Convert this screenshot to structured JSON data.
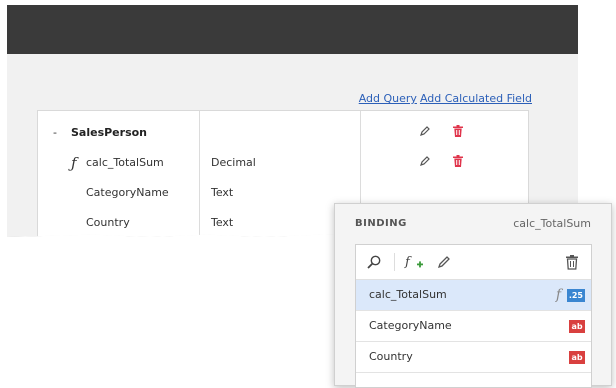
{
  "links": {
    "add_query": "Add Query",
    "add_calculated_field": "Add Calculated Field"
  },
  "table": {
    "root": {
      "toggle": "-",
      "name": "SalesPerson"
    },
    "rows": [
      {
        "name": "calc_TotalSum",
        "type": "Decimal",
        "icon": "function-icon"
      },
      {
        "name": "CategoryName",
        "type": "Text"
      },
      {
        "name": "Country",
        "type": "Text"
      }
    ]
  },
  "binding": {
    "title": "BINDING",
    "selected_field": "calc_TotalSum",
    "toolbar": [
      "search-icon",
      "add-calculated-field-icon",
      "edit-icon",
      "trash-icon"
    ],
    "fields": [
      {
        "name": "calc_TotalSum",
        "fx": "f",
        "badge": ".25",
        "badge_kind": "number",
        "selected": true
      },
      {
        "name": "CategoryName",
        "badge": "ab",
        "badge_kind": "string"
      },
      {
        "name": "Country",
        "badge": "ab",
        "badge_kind": "string"
      }
    ]
  },
  "colors": {
    "link": "#2b5fb8",
    "delete": "#e0344b",
    "selected_row": "#dbe8fa",
    "number_badge": "#3a86d1",
    "string_badge": "#d9403f",
    "header_bar": "#3a3a3a"
  }
}
